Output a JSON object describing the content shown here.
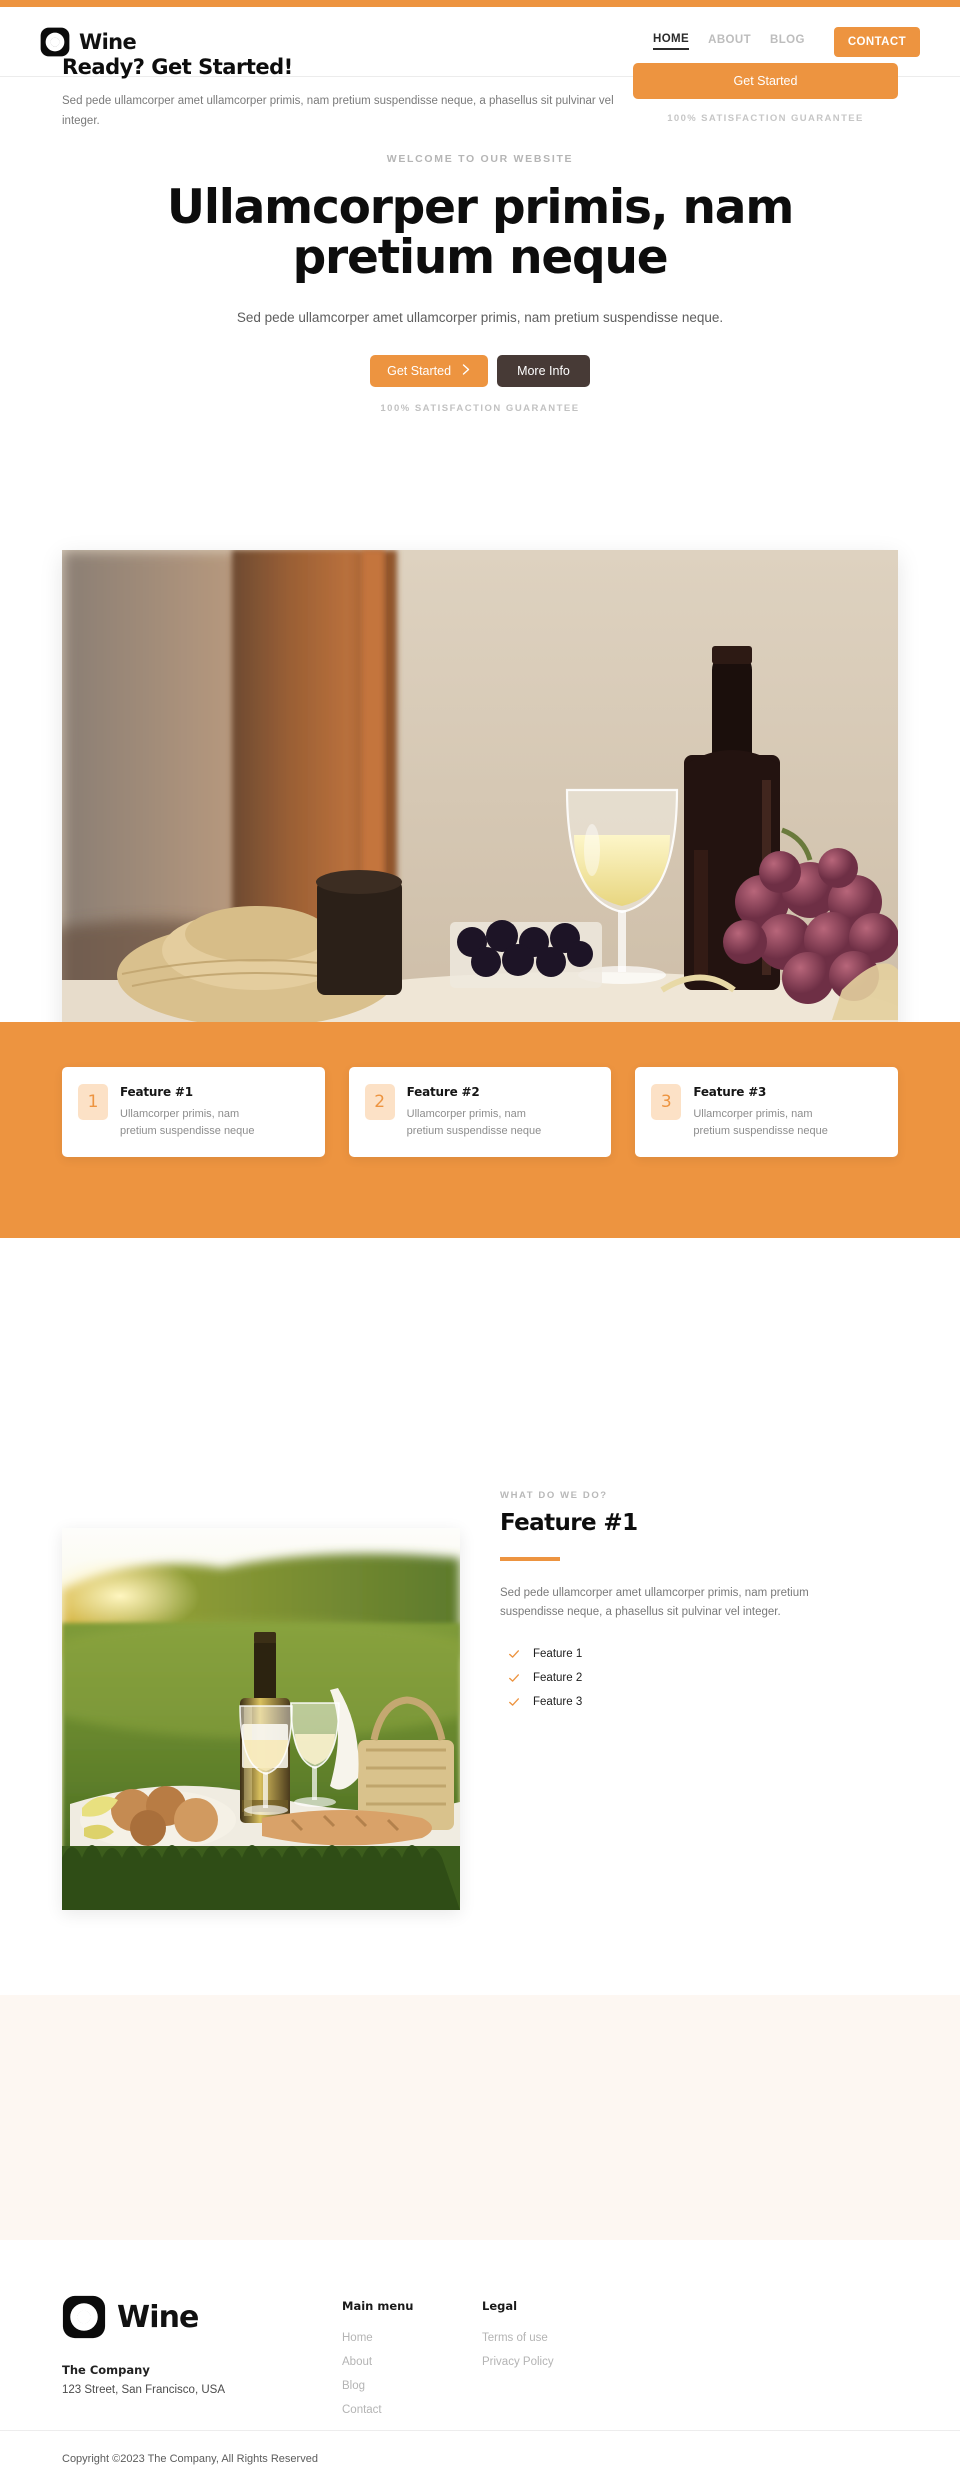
{
  "theme": {
    "accent": "#ED9440",
    "accent_soft": "#FCE1C6",
    "dark_button": "#473A36",
    "cta_background": "#FDF7F2",
    "muted_text": "#b5b5b5"
  },
  "header": {
    "logo_icon": "wine-logo-icon",
    "brand_name": "Wine",
    "nav": [
      {
        "label": "HOME",
        "active": true
      },
      {
        "label": "ABOUT",
        "active": false
      },
      {
        "label": "BLOG",
        "active": false
      }
    ],
    "contact_label": "CONTACT"
  },
  "hero": {
    "eyebrow": "WELCOME TO OUR WEBSITE",
    "title": "Ullamcorper primis, nam pretium neque",
    "subtitle": "Sed pede ullamcorper amet ullamcorper primis, nam pretium suspendisse neque.",
    "primary_button": "Get Started",
    "primary_button_icon": "chevron-right-icon",
    "secondary_button": "More Info",
    "guarantee": "100% SATISFACTION GUARANTEE",
    "image_alt": "wine-bottle-glass-grapes-photo"
  },
  "features": [
    {
      "number": "1",
      "title": "Feature #1",
      "description": "Ullamcorper primis, nam pretium suspendisse neque"
    },
    {
      "number": "2",
      "title": "Feature #2",
      "description": "Ullamcorper primis, nam pretium suspendisse neque"
    },
    {
      "number": "3",
      "title": "Feature #3",
      "description": "Ullamcorper primis, nam pretium suspendisse neque"
    }
  ],
  "about": {
    "image_alt": "picnic-wine-sunset-photo",
    "eyebrow": "WHAT DO WE DO?",
    "title": "Feature #1",
    "description": "Sed pede ullamcorper amet ullamcorper primis, nam pretium suspendisse neque, a phasellus sit pulvinar vel integer.",
    "checklist": [
      {
        "icon": "check-icon",
        "label": "Feature 1"
      },
      {
        "icon": "check-icon",
        "label": "Feature 2"
      },
      {
        "icon": "check-icon",
        "label": "Feature 3"
      }
    ]
  },
  "cta": {
    "title": "Ready? Get Started!",
    "description": "Sed pede ullamcorper amet ullamcorper primis, nam pretium suspendisse neque, a phasellus sit pulvinar vel integer.",
    "button_label": "Get Started",
    "guarantee": "100% SATISFACTION GUARANTEE"
  },
  "footer": {
    "logo_icon": "wine-logo-icon",
    "brand_name": "Wine",
    "company": "The Company",
    "address": "123 Street, San Francisco, USA",
    "columns": [
      {
        "title": "Main menu",
        "links": [
          "Home",
          "About",
          "Blog",
          "Contact"
        ]
      },
      {
        "title": "Legal",
        "links": [
          "Terms of use",
          "Privacy Policy"
        ]
      }
    ],
    "copyright": "Copyright ©2023 The Company, All Rights Reserved"
  }
}
